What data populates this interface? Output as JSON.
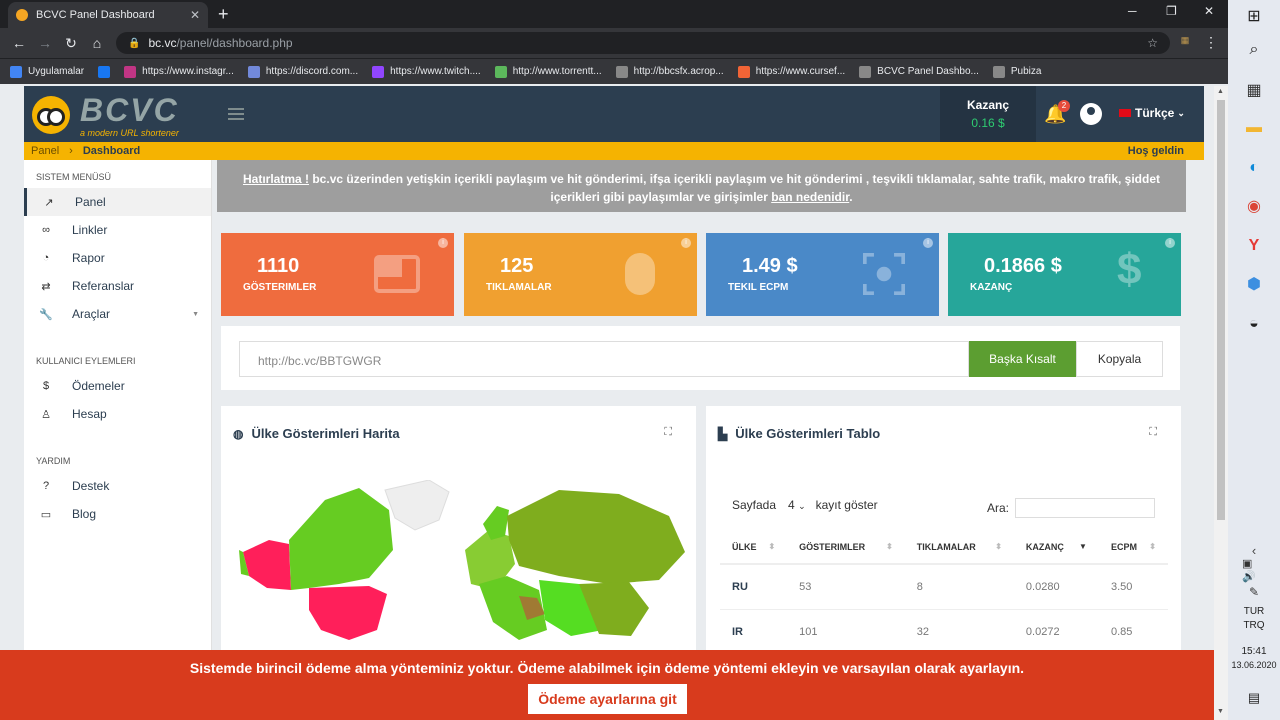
{
  "browser": {
    "tab_title": "BCVC Panel Dashboard",
    "url_domain": "bc.vc",
    "url_path": "/panel/dashboard.php",
    "bookmarks": [
      {
        "label": "Uygulamalar",
        "color": "#4285f4"
      },
      {
        "label": "",
        "color": "#1877f2"
      },
      {
        "label": "https://www.instagr...",
        "color": "#c13584"
      },
      {
        "label": "https://discord.com...",
        "color": "#7289da"
      },
      {
        "label": "https://www.twitch....",
        "color": "#9146ff"
      },
      {
        "label": "http://www.torrentt...",
        "color": "#5cb85c"
      },
      {
        "label": "http://bbcsfx.acrop...",
        "color": "#888888"
      },
      {
        "label": "https://www.cursef...",
        "color": "#f16436"
      },
      {
        "label": "BCVC Panel Dashbo...",
        "color": "#888888"
      },
      {
        "label": "Pubiza",
        "color": "#888888"
      }
    ]
  },
  "header": {
    "logo_word": "BCVC",
    "logo_tagline": "a modern URL shortener",
    "earnings_label": "Kazanç",
    "earnings_value": "0.16 $",
    "notif_count": "2",
    "language": "Türkçe"
  },
  "breadcrumb": {
    "root": "Panel",
    "current": "Dashboard",
    "welcome": "Hoş geldin"
  },
  "sidebar": {
    "sections": [
      {
        "title": "SISTEM MENÜSÜ",
        "items": [
          {
            "label": "Panel",
            "icon": "trend-icon",
            "glyph": "↗",
            "active": true
          },
          {
            "label": "Linkler",
            "icon": "link-icon",
            "glyph": "∞"
          },
          {
            "label": "Rapor",
            "icon": "report-icon",
            "glyph": "◔"
          },
          {
            "label": "Referanslar",
            "icon": "swap-icon",
            "glyph": "⇄"
          },
          {
            "label": "Araçlar",
            "icon": "wrench-icon",
            "glyph": "🔧",
            "caret": true
          }
        ]
      },
      {
        "title": "KULLANICI EYLEMLERI",
        "items": [
          {
            "label": "Ödemeler",
            "icon": "dollar-icon",
            "glyph": "$"
          },
          {
            "label": "Hesap",
            "icon": "account-icon",
            "glyph": "♙"
          }
        ]
      },
      {
        "title": "YARDIM",
        "items": [
          {
            "label": "Destek",
            "icon": "help-icon",
            "glyph": "?"
          },
          {
            "label": "Blog",
            "icon": "blog-icon",
            "glyph": "▭"
          }
        ]
      }
    ]
  },
  "notice": {
    "lead": "Hatırlatma !",
    "text": " bc.vc üzerinden yetişkin içerikli paylaşım ve hit gönderimi, ifşa içerikli paylaşım ve hit gönderimi , teşvikli tıklamalar, sahte trafik, makro trafik, şiddet içerikleri gibi paylaşımlar ve girişimler ",
    "link": "ban nedenidir",
    "end": "."
  },
  "stats": [
    {
      "value": "1110",
      "label": "GÖSTERIMLER",
      "color": "#ef6c3e",
      "icon": "window-icon"
    },
    {
      "value": "125",
      "label": "TIKLAMALAR",
      "color": "#f0a030",
      "icon": "mouse-icon"
    },
    {
      "value": "1.49 $",
      "label": "TEKIL ECPM",
      "color": "#4a89c8",
      "icon": "focus-icon"
    },
    {
      "value": "0.1866 $",
      "label": "KAZANÇ",
      "color": "#26a69a",
      "icon": "dollar-icon"
    }
  ],
  "shortener": {
    "url": "http://bc.vc/BBTGWGR",
    "shorten_label": "Başka Kısalt",
    "copy_label": "Kopyala"
  },
  "map_panel": {
    "title": "Ülke Gösterimleri Harita"
  },
  "table_panel": {
    "title": "Ülke Gösterimleri Tablo",
    "per_page_label": "Sayfada",
    "per_page_value": "4",
    "records_label": "kayıt göster",
    "search_label": "Ara:",
    "columns": [
      "ÜLKE",
      "GÖSTERIMLER",
      "TIKLAMALAR",
      "KAZANÇ",
      "ECPM"
    ],
    "rows": [
      [
        "RU",
        "53",
        "8",
        "0.0280",
        "3.50"
      ],
      [
        "IR",
        "101",
        "32",
        "0.0272",
        "0.85"
      ]
    ]
  },
  "banner": {
    "message": "Sistemde birincil ödeme alma yönteminiz yoktur. Ödeme alabilmek için ödeme yöntemi ekleyin ve varsayılan olarak ayarlayın.",
    "button": "Ödeme ayarlarına git"
  },
  "taskbar": {
    "lang1": "TUR",
    "lang2": "TRQ",
    "time": "15:41",
    "date": "13.06.2020"
  }
}
